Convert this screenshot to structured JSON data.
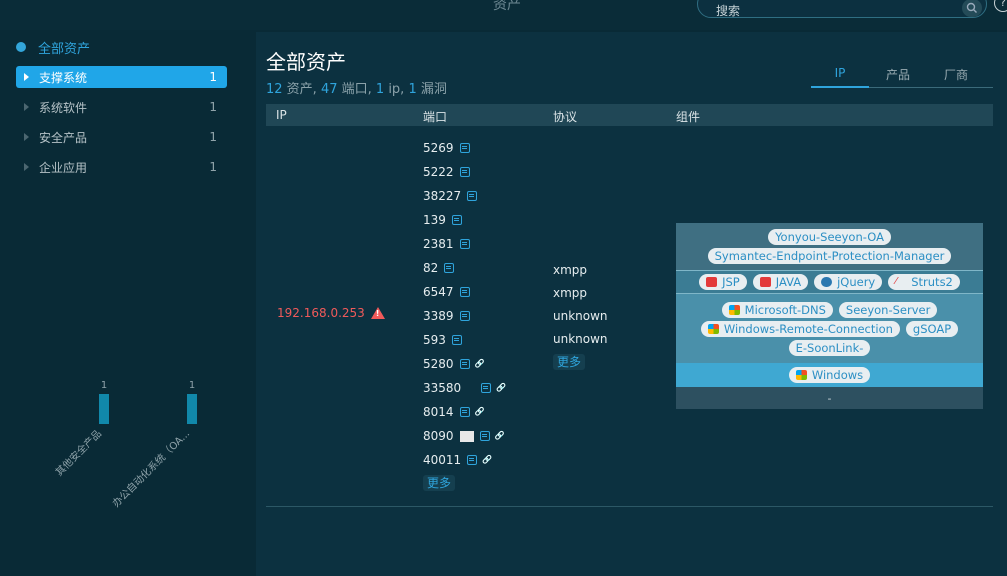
{
  "topbar": {
    "title": "资产",
    "search_placeholder": "搜索",
    "help_icon": "?"
  },
  "sidebar": {
    "all_label": "全部资产",
    "items": [
      {
        "label": "支撑系统",
        "count": "1",
        "active": true
      },
      {
        "label": "系统软件",
        "count": "1",
        "active": false
      },
      {
        "label": "安全产品",
        "count": "1",
        "active": false
      },
      {
        "label": "企业应用",
        "count": "1",
        "active": false
      }
    ]
  },
  "mini_chart": {
    "categories": [
      "其他安全产品",
      "办公自动化系统（OA..."
    ],
    "values": [
      1,
      1
    ]
  },
  "main": {
    "title": "全部资产",
    "summary": {
      "assets": "12",
      "assets_label": " 资产, ",
      "ports": "47",
      "ports_label": " 端口, ",
      "ips": "1",
      "ips_label": " ip, ",
      "vulns": "1",
      "vulns_label": " 漏洞"
    },
    "tabs": [
      "IP",
      "产品",
      "厂商"
    ],
    "columns": {
      "ip": "IP",
      "port": "端口",
      "protocol": "协议",
      "component": "组件"
    },
    "row": {
      "ip": "192.168.0.253",
      "ports": [
        {
          "num": "5269",
          "link": false,
          "thumb": false
        },
        {
          "num": "5222",
          "link": false,
          "thumb": false
        },
        {
          "num": "38227",
          "link": false,
          "thumb": false
        },
        {
          "num": "139",
          "link": false,
          "thumb": false
        },
        {
          "num": "2381",
          "link": false,
          "thumb": false
        },
        {
          "num": "82",
          "link": false,
          "thumb": false
        },
        {
          "num": "6547",
          "link": false,
          "thumb": false
        },
        {
          "num": "3389",
          "link": false,
          "thumb": false
        },
        {
          "num": "593",
          "link": false,
          "thumb": false
        },
        {
          "num": "5280",
          "link": true,
          "thumb": false
        },
        {
          "num": "33580",
          "link": true,
          "thumb": false
        },
        {
          "num": "8014",
          "link": true,
          "thumb": false
        },
        {
          "num": "8090",
          "link": true,
          "thumb": true
        },
        {
          "num": "40011",
          "link": true,
          "thumb": false
        }
      ],
      "ports_more": "更多",
      "protocols": [
        "xmpp",
        "xmpp",
        "unknown",
        "unknown"
      ],
      "protocols_more": "更多",
      "components": {
        "application": [
          "Yonyou-Seeyon-OA",
          "Symantec-Endpoint-Protection-Manager"
        ],
        "framework": [
          {
            "name": "JSP",
            "icon": "java-icon"
          },
          {
            "name": "JAVA",
            "icon": "java-icon"
          },
          {
            "name": "jQuery",
            "icon": "jquery-icon"
          },
          {
            "name": "Struts2",
            "icon": "struts-icon"
          }
        ],
        "service": [
          {
            "name": "Microsoft-DNS",
            "icon": "windows-icon"
          },
          {
            "name": "Seeyon-Server",
            "icon": ""
          },
          {
            "name": "Windows-Remote-Connection",
            "icon": "windows-icon"
          },
          {
            "name": "gSOAP",
            "icon": ""
          },
          {
            "name": "E-SoonLink-",
            "icon": ""
          }
        ],
        "os": [
          {
            "name": "Windows",
            "icon": "windows-icon"
          }
        ],
        "hardware": "-"
      }
    }
  }
}
